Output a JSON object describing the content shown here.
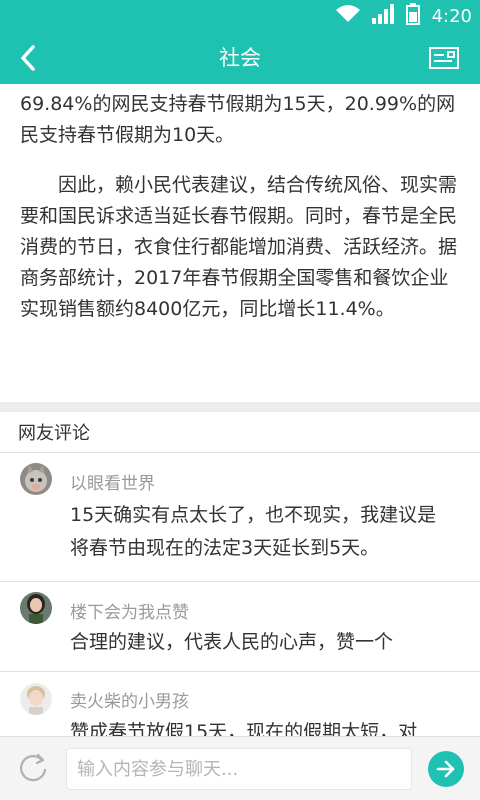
{
  "status_bar": {
    "time": "4:20"
  },
  "header": {
    "title": "社会"
  },
  "article": {
    "paragraphs": [
      "69.84%的网民支持春节假期为15天，20.99%的网民支持春节假期为10天。",
      "因此，赖小民代表建议，结合传统风俗、现实需要和国民诉求适当延长春节假期。同时，春节是全民消费的节日，衣食住行都能增加消费、活跃经济。据商务部统计，2017年春节假期全国零售和餐饮企业实现销售额约8400亿元，同比增长11.4%。"
    ]
  },
  "comments_section": {
    "title": "网友评论",
    "comments": [
      {
        "name": "以眼看世界",
        "text": "15天确实有点太长了，也不现实，我建议是将春节由现在的法定3天延长到5天。"
      },
      {
        "name": "楼下会为我点赞",
        "text": "合理的建议，代表人民的心声，赞一个"
      },
      {
        "name": "卖火柴的小男孩",
        "text": "赞成春节放假15天，现在的假期太短，对"
      }
    ]
  },
  "bottom_bar": {
    "input_placeholder": "输入内容参与聊天..."
  },
  "colors": {
    "accent": "#1fc1b1"
  }
}
